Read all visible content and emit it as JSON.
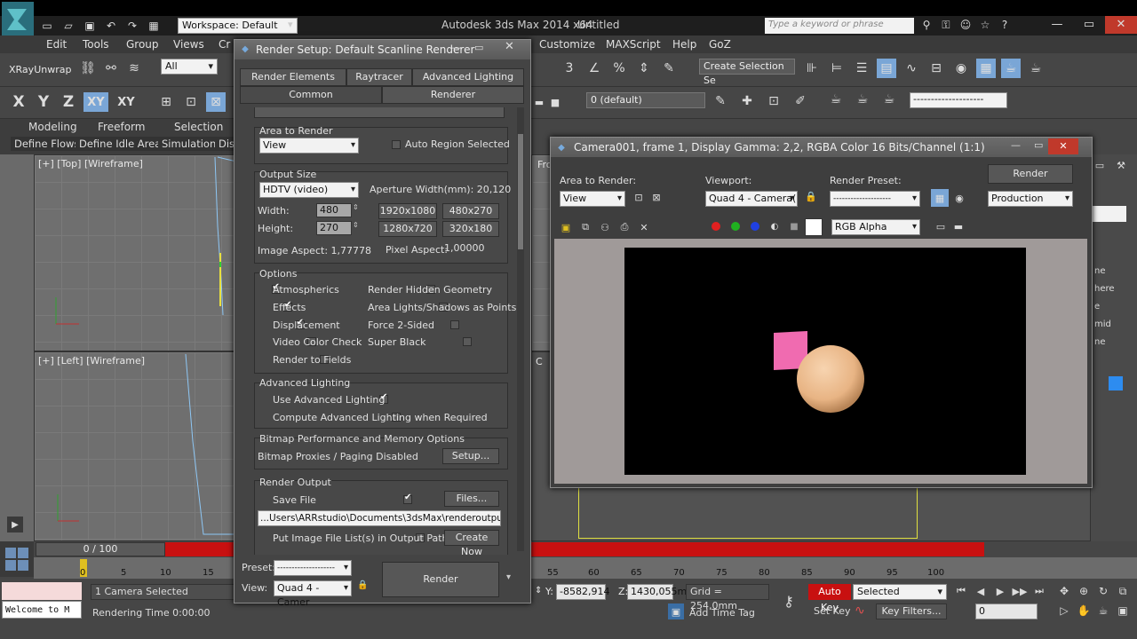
{
  "titlebar": {
    "workspace": "Workspace: Default",
    "app_title": "Autodesk 3ds Max  2014 x64",
    "doc_title": "Untitled",
    "search_placeholder": "Type a keyword or phrase"
  },
  "menu": [
    "Edit",
    "Tools",
    "Group",
    "Views",
    "Cr",
    "Customize",
    "MAXScript",
    "Help",
    "GoZ"
  ],
  "toolbar": {
    "xray": "XRayUnwrap",
    "selection_filter": "All",
    "create_selection_set": "Create Selection Se",
    "layer": "0 (default)",
    "axis_labels": [
      "X",
      "Y",
      "Z",
      "XY",
      "XY"
    ]
  },
  "ribbon": {
    "tabs": [
      "Modeling",
      "Freeform",
      "Selection"
    ],
    "subtabs": [
      "Define Flows",
      "Define Idle Areas",
      "Simulation",
      "Dis"
    ]
  },
  "viewports": {
    "top_label": "[+] [Top] [Wireframe]",
    "left_label": "[+] [Left] [Wireframe]",
    "front_partial": "Fro"
  },
  "timeline": {
    "frame": "0 / 100",
    "ticks_left": [
      "0",
      "5",
      "10",
      "15"
    ],
    "ticks_right": [
      "55",
      "60",
      "65",
      "70",
      "75",
      "80",
      "85",
      "90",
      "95",
      "100"
    ]
  },
  "status": {
    "script_listener": "Welcome to M",
    "selected": "1 Camera Selected",
    "rendering_time": "Rendering Time  0:00:00",
    "y_label": "Y:",
    "y_value": "-8582,914",
    "z_label": "Z:",
    "z_value": "1430,055m",
    "grid": "Grid = 254,0mm",
    "add_time_tag": "Add Time Tag",
    "auto_key": "Auto Key",
    "selected_combo": "Selected",
    "set_key": "Set Key",
    "key_filters": "Key Filters...",
    "frame_field": "0"
  },
  "render_setup": {
    "title": "Render Setup: Default Scanline Renderer",
    "tabs_row1": [
      "Render Elements",
      "Raytracer",
      "Advanced Lighting"
    ],
    "tabs_row2": [
      "Common",
      "Renderer"
    ],
    "area_to_render_title": "Area to Render",
    "area_to_render": "View",
    "auto_region": "Auto Region Selected",
    "output_size_title": "Output Size",
    "output_size": "HDTV (video)",
    "aperture": "Aperture Width(mm): 20,120",
    "width_label": "Width:",
    "width": "480",
    "height_label": "Height:",
    "height": "270",
    "presets": [
      "1920x1080",
      "480x270",
      "1280x720",
      "320x180"
    ],
    "image_aspect": "Image Aspect: 1,77778",
    "pixel_aspect_label": "Pixel Aspect:",
    "pixel_aspect": "1,00000",
    "options_title": "Options",
    "options_left": [
      {
        "label": "Atmospherics",
        "on": true
      },
      {
        "label": "Effects",
        "on": true
      },
      {
        "label": "Displacement",
        "on": true
      },
      {
        "label": "Video Color Check",
        "on": false
      },
      {
        "label": "Render to Fields",
        "on": false
      }
    ],
    "options_right": [
      {
        "label": "Render Hidden Geometry",
        "on": false
      },
      {
        "label": "Area Lights/Shadows as Points",
        "on": false
      },
      {
        "label": "Force 2-Sided",
        "on": false
      },
      {
        "label": "Super Black",
        "on": false
      }
    ],
    "adv_lighting_title": "Advanced Lighting",
    "use_adv_lighting": "Use Advanced Lighting",
    "compute_adv_lighting": "Compute Advanced Lighting when Required",
    "bitmap_title": "Bitmap Performance and Memory Options",
    "bitmap_proxies": "Bitmap Proxies / Paging Disabled",
    "setup_btn": "Setup...",
    "render_output_title": "Render Output",
    "save_file": "Save File",
    "files_btn": "Files...",
    "output_path": "...Users\\ARRstudio\\Documents\\3dsMax\\renderoutput\\1.jpg",
    "put_image_list": "Put Image File List(s) in Output Path(s)",
    "create_now": "Create Now",
    "preset_label": "Preset:",
    "preset_value": "--------------------",
    "view_label": "View:",
    "view_value": "Quad 4 - Camer",
    "render_btn": "Render"
  },
  "render_frame": {
    "title": "Camera001, frame 1, Display Gamma: 2,2, RGBA Color 16 Bits/Channel (1:1)",
    "area_label": "Area to Render:",
    "area_value": "View",
    "viewport_label": "Viewport:",
    "viewport_value": "Quad 4 - Camera(",
    "preset_label": "Render Preset:",
    "preset_value": "--------------------",
    "render_btn": "Render",
    "production": "Production",
    "channel": "RGB Alpha",
    "colors": {
      "sphere": "#f0c49a",
      "box": "#f06bb0"
    }
  },
  "right_panel": {
    "fragments": [
      "ne",
      "here",
      "e",
      "mid",
      "ne"
    ]
  }
}
